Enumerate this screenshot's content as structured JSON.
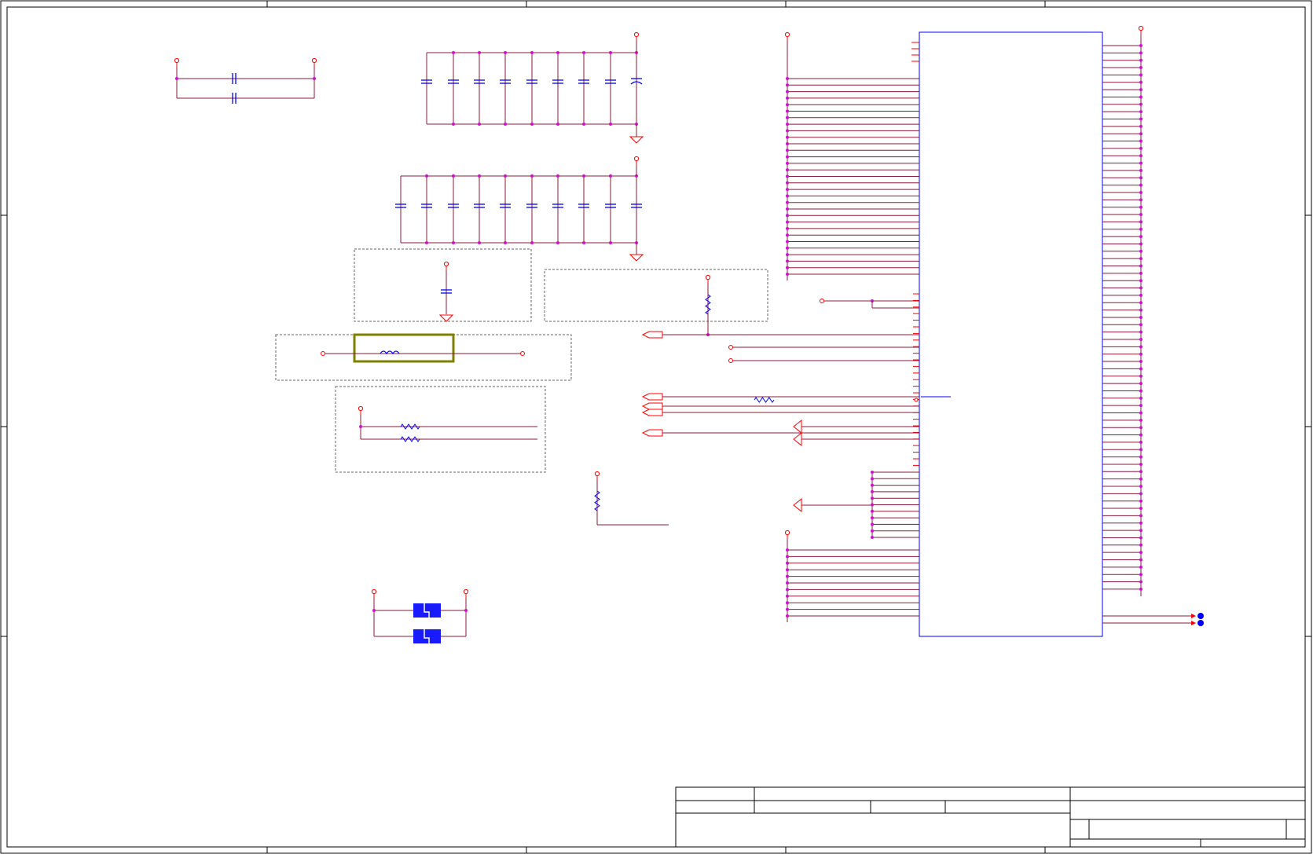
{
  "sheet": {
    "background": "#ffffff",
    "border_color": "#000000"
  },
  "colors": {
    "wire": "#8b1a3a",
    "pin": "#ff0000",
    "junction": "#d010d0",
    "component": "#0000ff",
    "component_body": "#1a1aff",
    "highlight_box": "#808000",
    "group_box": "#666666",
    "title_block": "#000000"
  },
  "icons": {
    "power_port": "small-circle-terminal",
    "ground": "triangle-ground",
    "capacitor": "capacitor-symbol",
    "resistor": "zigzag-resistor",
    "off_page_connector": "arrow-port",
    "crystal": "blue-crystal-block"
  },
  "title_block": {
    "title": "",
    "size": "",
    "number": "",
    "revision": "",
    "date": "",
    "sheet": ""
  }
}
